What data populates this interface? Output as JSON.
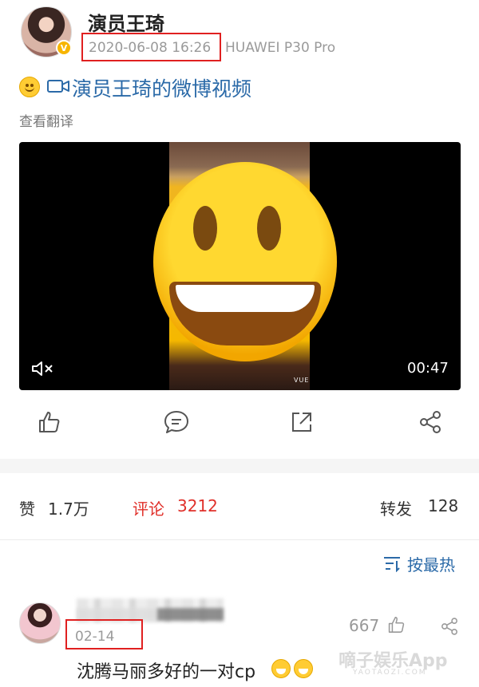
{
  "post": {
    "username": "演员王琦",
    "verified_badge": "V",
    "timestamp": "2020-06-08 16:26",
    "device": "HUAWEI P30 Pro",
    "text": "演员王琦的微博视频",
    "translate_label": "查看翻译"
  },
  "video": {
    "duration": "00:47",
    "watermark": "VUE"
  },
  "actions": {
    "icons": [
      "like-icon",
      "comment-icon",
      "repost-icon",
      "share-icon"
    ]
  },
  "stats": {
    "likes_label": "赞",
    "likes_value": "1.7万",
    "comments_label": "评论",
    "comments_value": "3212",
    "reposts_label": "转发",
    "reposts_value": "128",
    "accent_color": "#e0302a"
  },
  "sort": {
    "label": "按最热"
  },
  "comment": {
    "date": "02-14",
    "likes": "667",
    "text": "沈腾马丽多好的一对cp"
  },
  "watermark": {
    "text": "嘀子娱乐App",
    "sub": "YAOTAOZI.COM"
  },
  "colors": {
    "link": "#2b6aa8",
    "highlight_box": "#e02020"
  }
}
